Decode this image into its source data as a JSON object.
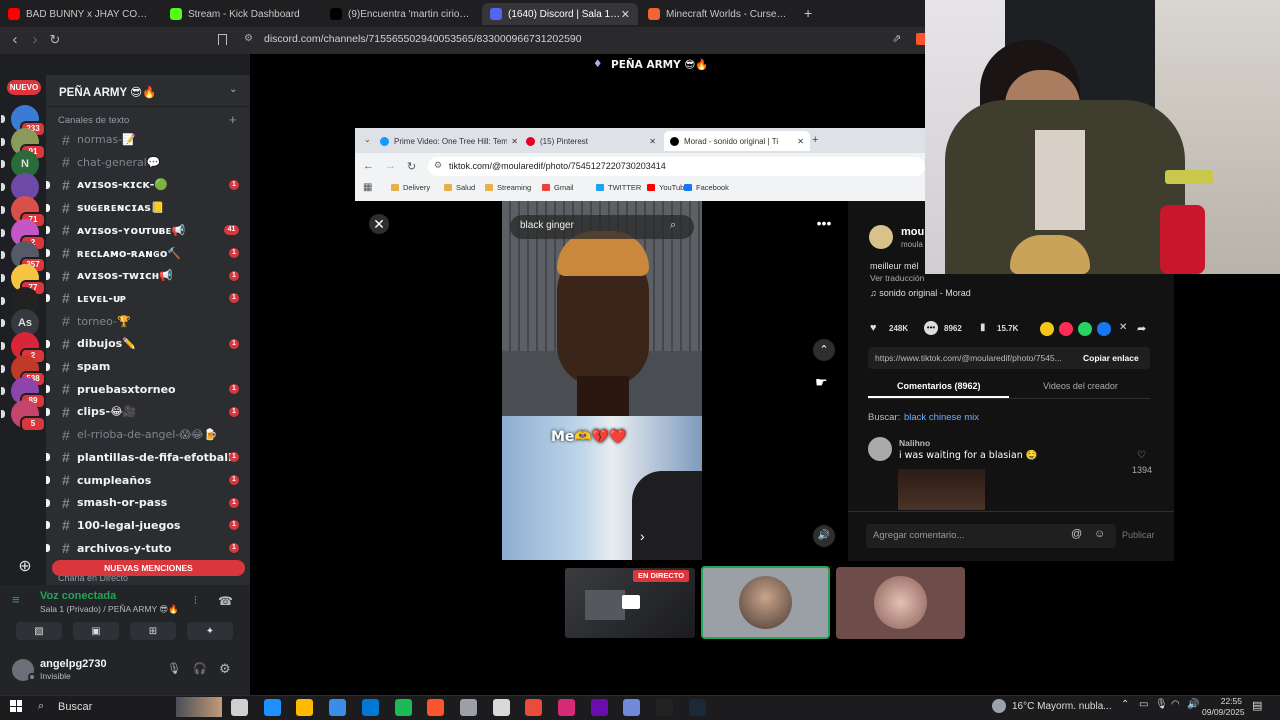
{
  "browser": {
    "tabs": [
      {
        "label": "BAD BUNNY x JHAY CORTEZ - DÁKI",
        "color": "#ff0000"
      },
      {
        "label": "Stream - Kick Dashboard",
        "color": "#53fc18"
      },
      {
        "label": "(9)Encuentra 'martin cirio peru ' en",
        "color": "#000000"
      },
      {
        "label": "(1640) Discord | Sala 1 (Priva",
        "color": "#5865f2"
      },
      {
        "label": "Minecraft Worlds - CurseForge",
        "color": "#f16436"
      }
    ],
    "new_tab": "+",
    "url": "discord.com/channels/715565502940053565/833000966731202590"
  },
  "discord": {
    "new_badge": "NUEVO",
    "server_name": "PEÑA ARMY 😎🔥",
    "stage_title": "PEÑA ARMY 😎🔥",
    "section_text": "Canales de texto",
    "section_direct": "Charla en Directo",
    "servers": [
      {
        "badge": "233",
        "color": "#3a7bd5"
      },
      {
        "badge": "91",
        "color": "#8a9a5b"
      },
      {
        "badge": "",
        "color": "#2b6b3a",
        "letter": "N"
      },
      {
        "badge": "",
        "color": "#6e4aa8"
      },
      {
        "badge": "71",
        "color": "#d9504a"
      },
      {
        "badge": "2",
        "color": "#c456c8"
      },
      {
        "badge": "357",
        "color": "#555a66"
      },
      {
        "badge": "77",
        "color": "#f5c542"
      },
      {
        "badge": "",
        "color": "#222222"
      },
      {
        "badge": "",
        "color": "#36393f",
        "letter": "As"
      },
      {
        "badge": "2",
        "color": "#d72638"
      },
      {
        "badge": "538",
        "color": "#c0392b"
      },
      {
        "badge": "89",
        "color": "#8e44ad"
      },
      {
        "badge": "5",
        "color": "#c44569"
      }
    ],
    "channels": [
      {
        "name": "normas-📝",
        "unread": false,
        "mentions": ""
      },
      {
        "name": "chat-general💬",
        "unread": false,
        "mentions": ""
      },
      {
        "name": "ᴀᴠɪsᴏs-ᴋɪᴄᴋ-🟢",
        "unread": true,
        "mentions": "1"
      },
      {
        "name": "sᴜɢᴇʀᴇɴᴄɪᴀs📒",
        "unread": true,
        "mentions": ""
      },
      {
        "name": "ᴀᴠɪsᴏs-ʏᴏᴜᴛᴜʙᴇ📢",
        "unread": true,
        "mentions": "41"
      },
      {
        "name": "ʀᴇᴄʟᴀᴍᴏ-ʀᴀɴɢᴏ🔨",
        "unread": true,
        "mentions": "1"
      },
      {
        "name": "ᴀᴠɪsᴏs-ᴛᴡɪᴄʜ📢",
        "unread": true,
        "mentions": "1"
      },
      {
        "name": "ʟᴇᴠᴇʟ-ᴜᴘ",
        "unread": true,
        "mentions": "1"
      },
      {
        "name": "torneo-🏆",
        "unread": false,
        "mentions": ""
      },
      {
        "name": "dibujos✏️",
        "unread": true,
        "mentions": "1"
      },
      {
        "name": "spam",
        "unread": true,
        "mentions": ""
      },
      {
        "name": "pruebasxtorneo",
        "unread": true,
        "mentions": "1"
      },
      {
        "name": "clips-😂🎥",
        "unread": true,
        "mentions": "1"
      },
      {
        "name": "el-rrioba-de-angel-😱😂🍺",
        "unread": false,
        "mentions": ""
      },
      {
        "name": "plantillas-de-fifa-efotball",
        "unread": true,
        "mentions": "1"
      },
      {
        "name": "cumpleaños",
        "unread": true,
        "mentions": "1"
      },
      {
        "name": "smash-or-pass",
        "unread": true,
        "mentions": "1"
      },
      {
        "name": "100-legal-juegos",
        "unread": true,
        "mentions": "1"
      },
      {
        "name": "archivos-y-tuto",
        "unread": true,
        "mentions": "1"
      }
    ],
    "new_mentions": "NUEVAS MENCIONES",
    "voice_status": "Voz conectada",
    "voice_channel": "Sala 1 (Privado) / PEÑA ARMY 😎🔥",
    "username": "angelpg2730",
    "user_status": "Invisible",
    "live_label": "EN DIRECTO"
  },
  "inner_browser": {
    "tabs": [
      {
        "label": "Prime Video: One Tree Hill: Tem",
        "color": "#1399ff"
      },
      {
        "label": "(15) Pinterest",
        "color": "#e60023"
      },
      {
        "label": "Morad - sonido original | Ti",
        "color": "#000000"
      }
    ],
    "url": "tiktok.com/@moularedif/photo/7545127220730203414",
    "bookmarks": [
      "Delivery",
      "Salud",
      "Streaming",
      "Gmail",
      "TWITTER",
      "YouTube",
      "Facebook"
    ]
  },
  "tiktok": {
    "search_text": "black ginger",
    "overlay_text": "Me🫶💔❤️",
    "user_short": "mou",
    "user_sub": "moula",
    "caption": "meilleur mél",
    "translate": "Ver traducción",
    "sound": "♫ sonido original - Morad",
    "likes": "248K",
    "comments_count": "8962",
    "saves": "15.7K",
    "link": "https://www.tiktok.com/@moularedif/photo/7545...",
    "copy_link": "Copiar enlace",
    "tab_comments": "Comentarios (8962)",
    "tab_videos": "Videos del creador",
    "search_label": "Buscar:",
    "search_suggestion": "black chinese mix",
    "comment_user": "Nalihno",
    "comment_text": "i was waiting for a blasian 🤤",
    "comment_likes": "1394",
    "add_comment": "Agregar comentario...",
    "publish": "Publicar"
  },
  "taskbar": {
    "search": "Buscar",
    "weather": "16°C  Mayorm. nubla...",
    "time": "22:55",
    "date": "09/09/2025"
  },
  "colors": {
    "discord_bg": "#2b2d31",
    "server_rail": "#1e1f22",
    "mention_red": "#da373c",
    "voice_green": "#23a55a",
    "tiktok_panel": "#121212"
  }
}
